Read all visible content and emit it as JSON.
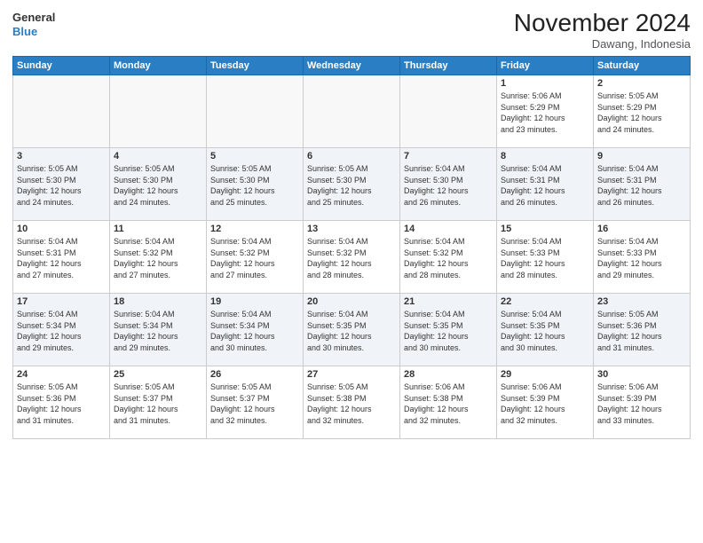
{
  "header": {
    "logo_line1": "General",
    "logo_line2": "Blue",
    "month": "November 2024",
    "location": "Dawang, Indonesia"
  },
  "weekdays": [
    "Sunday",
    "Monday",
    "Tuesday",
    "Wednesday",
    "Thursday",
    "Friday",
    "Saturday"
  ],
  "weeks": [
    [
      {
        "day": "",
        "info": ""
      },
      {
        "day": "",
        "info": ""
      },
      {
        "day": "",
        "info": ""
      },
      {
        "day": "",
        "info": ""
      },
      {
        "day": "",
        "info": ""
      },
      {
        "day": "1",
        "info": "Sunrise: 5:06 AM\nSunset: 5:29 PM\nDaylight: 12 hours\nand 23 minutes."
      },
      {
        "day": "2",
        "info": "Sunrise: 5:05 AM\nSunset: 5:29 PM\nDaylight: 12 hours\nand 24 minutes."
      }
    ],
    [
      {
        "day": "3",
        "info": "Sunrise: 5:05 AM\nSunset: 5:30 PM\nDaylight: 12 hours\nand 24 minutes."
      },
      {
        "day": "4",
        "info": "Sunrise: 5:05 AM\nSunset: 5:30 PM\nDaylight: 12 hours\nand 24 minutes."
      },
      {
        "day": "5",
        "info": "Sunrise: 5:05 AM\nSunset: 5:30 PM\nDaylight: 12 hours\nand 25 minutes."
      },
      {
        "day": "6",
        "info": "Sunrise: 5:05 AM\nSunset: 5:30 PM\nDaylight: 12 hours\nand 25 minutes."
      },
      {
        "day": "7",
        "info": "Sunrise: 5:04 AM\nSunset: 5:30 PM\nDaylight: 12 hours\nand 26 minutes."
      },
      {
        "day": "8",
        "info": "Sunrise: 5:04 AM\nSunset: 5:31 PM\nDaylight: 12 hours\nand 26 minutes."
      },
      {
        "day": "9",
        "info": "Sunrise: 5:04 AM\nSunset: 5:31 PM\nDaylight: 12 hours\nand 26 minutes."
      }
    ],
    [
      {
        "day": "10",
        "info": "Sunrise: 5:04 AM\nSunset: 5:31 PM\nDaylight: 12 hours\nand 27 minutes."
      },
      {
        "day": "11",
        "info": "Sunrise: 5:04 AM\nSunset: 5:32 PM\nDaylight: 12 hours\nand 27 minutes."
      },
      {
        "day": "12",
        "info": "Sunrise: 5:04 AM\nSunset: 5:32 PM\nDaylight: 12 hours\nand 27 minutes."
      },
      {
        "day": "13",
        "info": "Sunrise: 5:04 AM\nSunset: 5:32 PM\nDaylight: 12 hours\nand 28 minutes."
      },
      {
        "day": "14",
        "info": "Sunrise: 5:04 AM\nSunset: 5:32 PM\nDaylight: 12 hours\nand 28 minutes."
      },
      {
        "day": "15",
        "info": "Sunrise: 5:04 AM\nSunset: 5:33 PM\nDaylight: 12 hours\nand 28 minutes."
      },
      {
        "day": "16",
        "info": "Sunrise: 5:04 AM\nSunset: 5:33 PM\nDaylight: 12 hours\nand 29 minutes."
      }
    ],
    [
      {
        "day": "17",
        "info": "Sunrise: 5:04 AM\nSunset: 5:34 PM\nDaylight: 12 hours\nand 29 minutes."
      },
      {
        "day": "18",
        "info": "Sunrise: 5:04 AM\nSunset: 5:34 PM\nDaylight: 12 hours\nand 29 minutes."
      },
      {
        "day": "19",
        "info": "Sunrise: 5:04 AM\nSunset: 5:34 PM\nDaylight: 12 hours\nand 30 minutes."
      },
      {
        "day": "20",
        "info": "Sunrise: 5:04 AM\nSunset: 5:35 PM\nDaylight: 12 hours\nand 30 minutes."
      },
      {
        "day": "21",
        "info": "Sunrise: 5:04 AM\nSunset: 5:35 PM\nDaylight: 12 hours\nand 30 minutes."
      },
      {
        "day": "22",
        "info": "Sunrise: 5:04 AM\nSunset: 5:35 PM\nDaylight: 12 hours\nand 30 minutes."
      },
      {
        "day": "23",
        "info": "Sunrise: 5:05 AM\nSunset: 5:36 PM\nDaylight: 12 hours\nand 31 minutes."
      }
    ],
    [
      {
        "day": "24",
        "info": "Sunrise: 5:05 AM\nSunset: 5:36 PM\nDaylight: 12 hours\nand 31 minutes."
      },
      {
        "day": "25",
        "info": "Sunrise: 5:05 AM\nSunset: 5:37 PM\nDaylight: 12 hours\nand 31 minutes."
      },
      {
        "day": "26",
        "info": "Sunrise: 5:05 AM\nSunset: 5:37 PM\nDaylight: 12 hours\nand 32 minutes."
      },
      {
        "day": "27",
        "info": "Sunrise: 5:05 AM\nSunset: 5:38 PM\nDaylight: 12 hours\nand 32 minutes."
      },
      {
        "day": "28",
        "info": "Sunrise: 5:06 AM\nSunset: 5:38 PM\nDaylight: 12 hours\nand 32 minutes."
      },
      {
        "day": "29",
        "info": "Sunrise: 5:06 AM\nSunset: 5:39 PM\nDaylight: 12 hours\nand 32 minutes."
      },
      {
        "day": "30",
        "info": "Sunrise: 5:06 AM\nSunset: 5:39 PM\nDaylight: 12 hours\nand 33 minutes."
      }
    ]
  ]
}
